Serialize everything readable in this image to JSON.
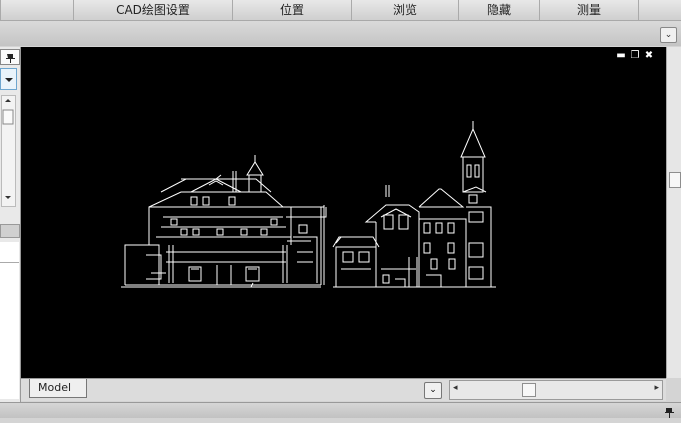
{
  "menu": {
    "items": [
      {
        "label": "CAD绘图设置"
      },
      {
        "label": "位置"
      },
      {
        "label": "浏览"
      },
      {
        "label": "隐藏"
      },
      {
        "label": "测量"
      }
    ]
  },
  "icons": {
    "ribbon_toggle": "chevron-down-icon",
    "pin": "pin-icon",
    "minimize": "minimize-icon",
    "restore": "restore-icon",
    "close": "close-icon"
  },
  "ribbon_toggle_glyph": "⌄",
  "window_controls": {
    "minimize": "▬",
    "restore": "❐",
    "close": "✖"
  },
  "layout_tabs": [
    {
      "label": "Model"
    }
  ],
  "colors": {
    "canvas": "#000000",
    "linework": "#ffffff"
  }
}
